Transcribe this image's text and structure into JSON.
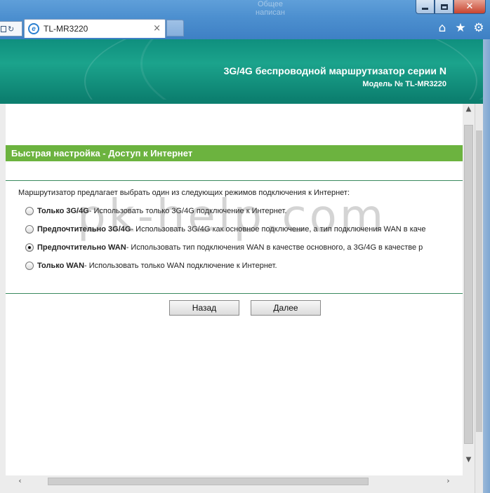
{
  "browser": {
    "desktop_text": "Общее\nнаписан",
    "tab_title": "TL-MR3220",
    "tab_close": "×",
    "addr_reload": "↻"
  },
  "banner": {
    "title": "3G/4G беспроводной маршрутизатор серии N",
    "model": "Модель № TL-MR3220"
  },
  "page": {
    "section_title": "Быстрая настройка - Доступ к Интернет",
    "intro": "Маршрутизатор предлагает выбрать один из следующих режимов подключения к Интернет:",
    "options": [
      {
        "label": "Только 3G/4G",
        "desc": " - Использовать только 3G/4G подключение к Интернет.",
        "selected": false
      },
      {
        "label": "Предпочтительно 3G/4G",
        "desc": " - Использовать 3G/4G как основное подключение, а тип подключения WAN в каче",
        "selected": false
      },
      {
        "label": "Предпочтительно WAN",
        "desc": " - Использовать тип подключения WAN в качестве основного, а 3G/4G в качестве р",
        "selected": true
      },
      {
        "label": "Только WAN",
        "desc": " - Использовать только WAN подключение к Интернет.",
        "selected": false
      }
    ],
    "back_button": "Назад",
    "next_button": "Далее"
  },
  "watermark": "pk-help.com",
  "colors": {
    "section_bar": "#6cb33f",
    "banner": "#1ba38c"
  },
  "icons": {
    "minimize": "minimize-icon",
    "maximize": "maximize-icon",
    "close": "close-icon",
    "home": "home-icon",
    "favorites": "star-icon",
    "tools": "gear-icon",
    "ie": "ie-logo-icon"
  }
}
